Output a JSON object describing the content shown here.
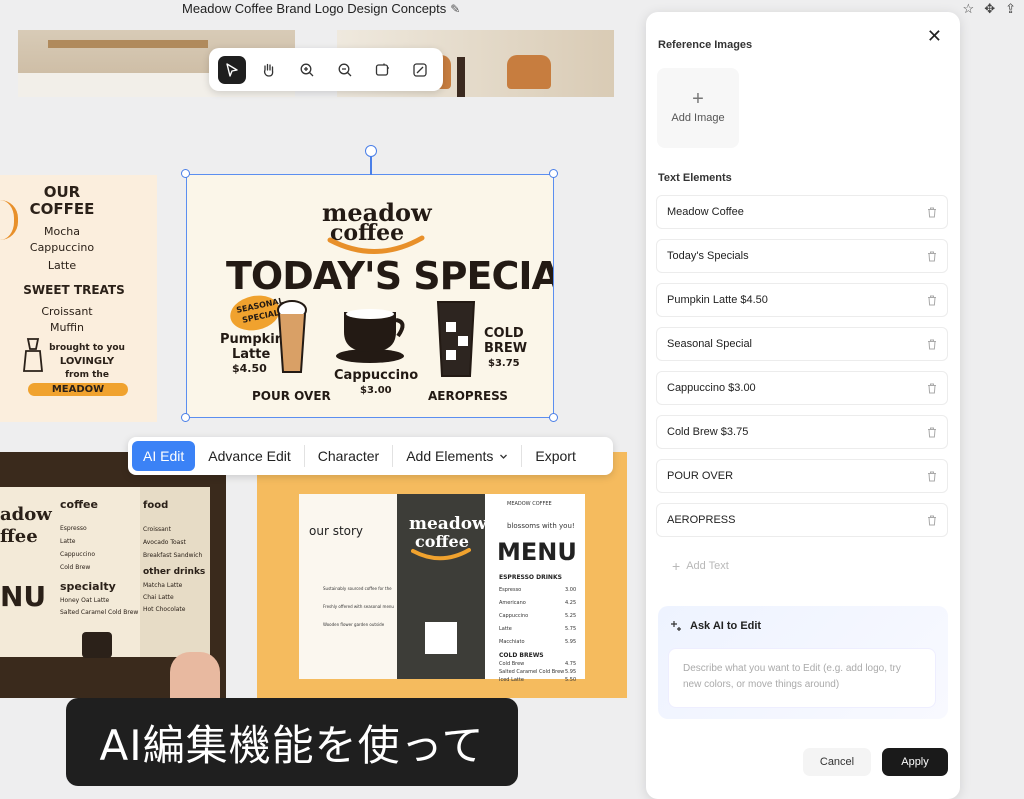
{
  "document": {
    "title": "Meadow Coffee Brand Logo Design Concepts"
  },
  "canvas_toolbar": {
    "tools": [
      "select-icon",
      "hand-icon",
      "zoom-in-icon",
      "zoom-out-icon",
      "frame-icon",
      "crop-icon"
    ],
    "active": "select-icon"
  },
  "left_card": {
    "lines": [
      "OUR",
      "COFFEE",
      "Mocha",
      "Cappuccino",
      "Latte",
      "SWEET TREATS",
      "Croissant",
      "Muffin",
      "brought to you",
      "LOVINGLY",
      "from the",
      "MEADOW"
    ]
  },
  "selected_card": {
    "brand_line1": "meadow",
    "brand_line2": "coffee",
    "headline": "TODAY'S SPECIALS",
    "badge_line1": "SEASONAL",
    "badge_line2": "SPECIAL",
    "item1_line1": "Pumpkin",
    "item1_line2": "Latte",
    "item1_price": "$4.50",
    "item2_name": "Cappuccino",
    "item2_price": "$3.00",
    "item3_line1": "COLD",
    "item3_line2": "BREW",
    "item3_price": "$3.75",
    "footer_left": "POUR OVER",
    "footer_right": "AEROPRESS"
  },
  "edit_bar": {
    "ai_edit": "AI Edit",
    "advance_edit": "Advance Edit",
    "character": "Character",
    "add_elements": "Add Elements",
    "export": "Export"
  },
  "bottom_left_menu": {
    "brand1": "adow",
    "brand2": "ffee",
    "menu": "NU",
    "col1_title": "coffee",
    "col1_items": [
      "Espresso",
      "Latte",
      "Cappuccino",
      "Cold Brew"
    ],
    "col2_title": "food",
    "col2_items": [
      "Croissant",
      "Avocado Toast",
      "Breakfast Sandwich"
    ],
    "specialty": "specialty",
    "specialty_items": [
      "Honey Oat Latte",
      "Salted Caramel Cold Brew"
    ],
    "other": "other drinks",
    "other_items": [
      "Matcha Latte",
      "Chai Latte",
      "Hot Chocolate"
    ]
  },
  "trifold": {
    "story_title": "our story",
    "story_points": [
      "Sustainably sourced coffee for the",
      "Freshly offered with seasonal menu",
      "Wooden flower garden outside"
    ],
    "brand1": "meadow",
    "brand2": "coffee",
    "small_brand": "MEADOW COFFEE",
    "welcome": "blossoms with you!",
    "menu_title": "MENU",
    "espresso_header": "ESPRESSO DRINKS",
    "espresso_items": [
      [
        "Espresso",
        "3.00"
      ],
      [
        "Americano",
        "4.25"
      ],
      [
        "Cappuccino",
        "5.25"
      ],
      [
        "Latte",
        "5.75"
      ],
      [
        "Macchiato",
        "5.95"
      ]
    ],
    "cold_header": "COLD BREWS",
    "cold_items": [
      [
        "Cold Brew",
        "4.75"
      ],
      [
        "Salted Caramel Cold Brew",
        "5.95"
      ],
      [
        "Iced Latte",
        "5.50"
      ]
    ]
  },
  "subtitle": "AI編集機能を使って",
  "panel": {
    "reference_title": "Reference Images",
    "add_image": "Add Image",
    "text_elements_title": "Text Elements",
    "text_elements": [
      "Meadow Coffee",
      "Today's Specials",
      "Pumpkin Latte $4.50",
      "Seasonal Special",
      "Cappuccino $3.00",
      "Cold Brew $3.75",
      "POUR OVER",
      "AEROPRESS"
    ],
    "add_text": "Add Text",
    "ask_ai_title": "Ask AI to Edit",
    "ask_ai_placeholder": "Describe what you want to Edit (e.g. add logo, try new colors, or move things around)",
    "cancel": "Cancel",
    "apply": "Apply"
  },
  "colors": {
    "accent": "#3b82f6",
    "selection": "#4a7fe8",
    "orange": "#e8902a",
    "dark": "#1a1a1a"
  }
}
